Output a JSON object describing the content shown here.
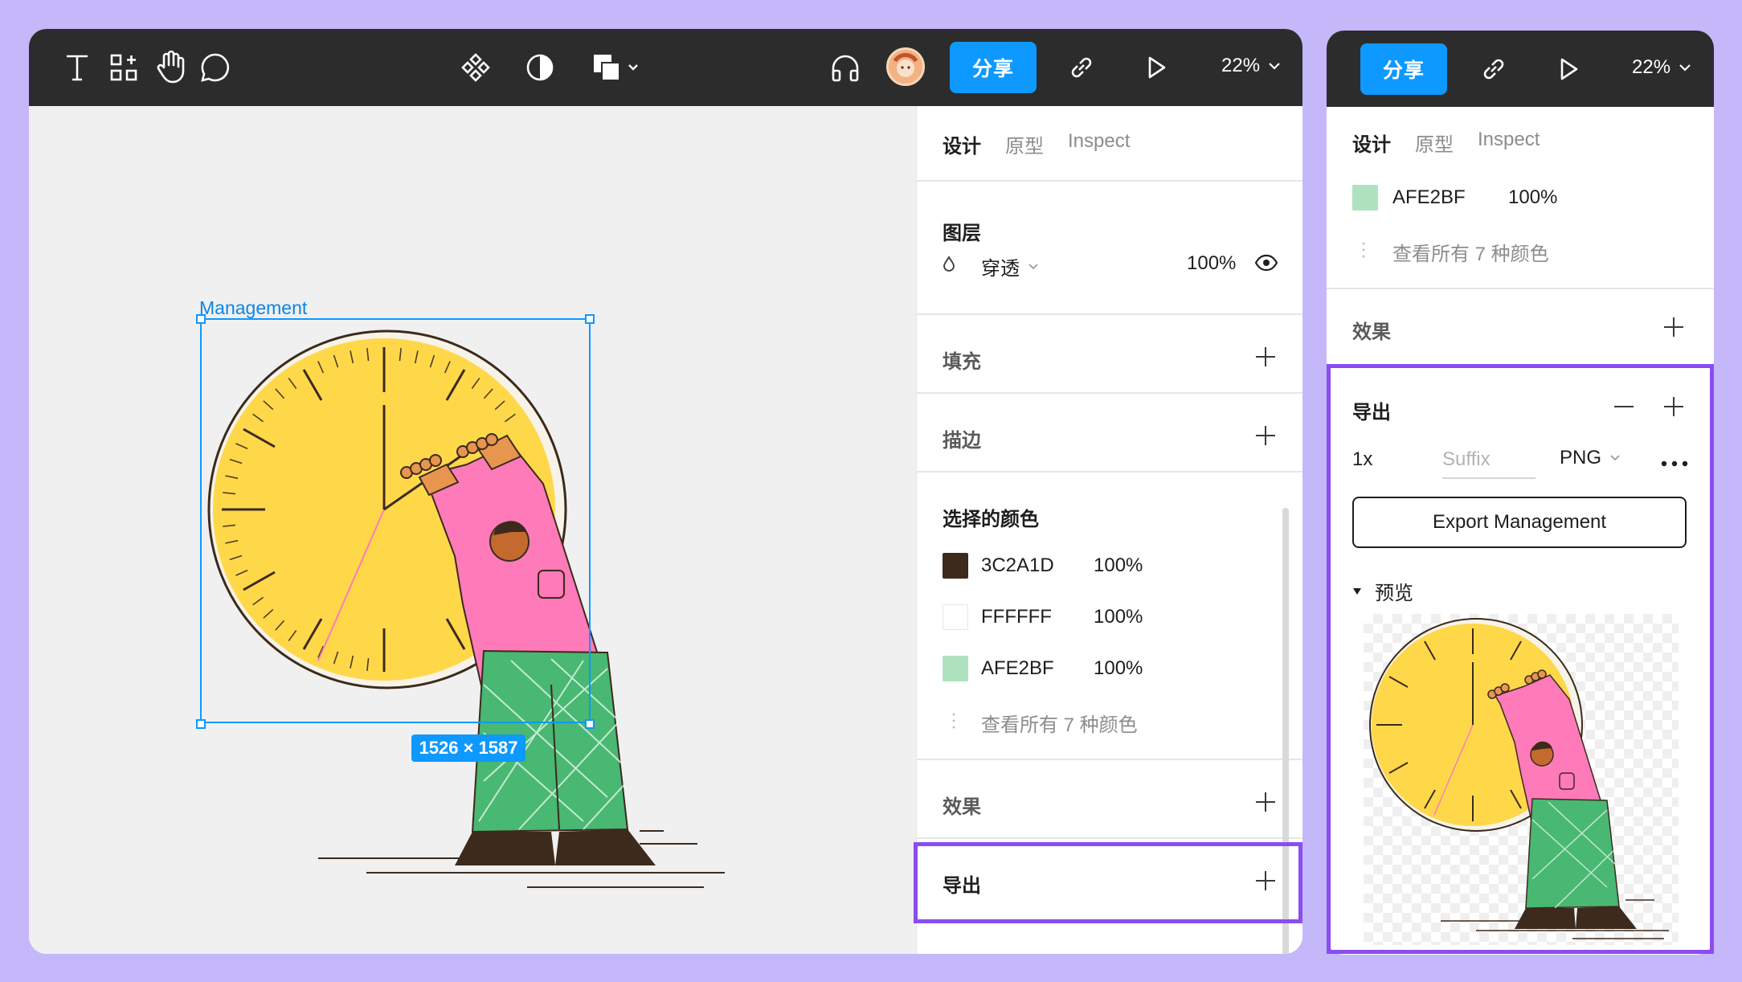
{
  "toolbar": {
    "share_label": "分享",
    "zoom_label": "22%"
  },
  "panel": {
    "tabs": [
      "设计",
      "原型",
      "Inspect"
    ],
    "layer": {
      "title": "图层",
      "blend_mode": "穿透",
      "opacity": "100%"
    },
    "fill": {
      "title": "填充"
    },
    "stroke": {
      "title": "描边"
    },
    "selected_colors": {
      "title": "选择的颜色",
      "colors": [
        {
          "hex": "3C2A1D",
          "opacity": "100%",
          "swatch": "#3c2a1d"
        },
        {
          "hex": "FFFFFF",
          "opacity": "100%",
          "swatch": "#ffffff"
        },
        {
          "hex": "AFE2BF",
          "opacity": "100%",
          "swatch": "#afe2bf"
        }
      ],
      "view_all": "查看所有 7 种颜色"
    },
    "effects": {
      "title": "效果"
    },
    "export": {
      "title": "导出"
    }
  },
  "canvas": {
    "frame_name": "Management",
    "frame_size": "1526 × 1587"
  },
  "zoomed": {
    "tabs": [
      "设计",
      "原型",
      "Inspect"
    ],
    "color": {
      "hex": "AFE2BF",
      "opacity": "100%",
      "swatch": "#afe2bf"
    },
    "view_all": "查看所有 7 种颜色",
    "effects_title": "效果",
    "export": {
      "title": "导出",
      "scale": "1x",
      "suffix_placeholder": "Suffix",
      "format": "PNG",
      "button_label": "Export Management",
      "preview_label": "预览"
    }
  },
  "colors": {
    "accent": "#0d99ff",
    "highlight": "#8b4cf0",
    "toolbar_bg": "#2c2c2c",
    "canvas_bg": "#f0f0f0"
  }
}
